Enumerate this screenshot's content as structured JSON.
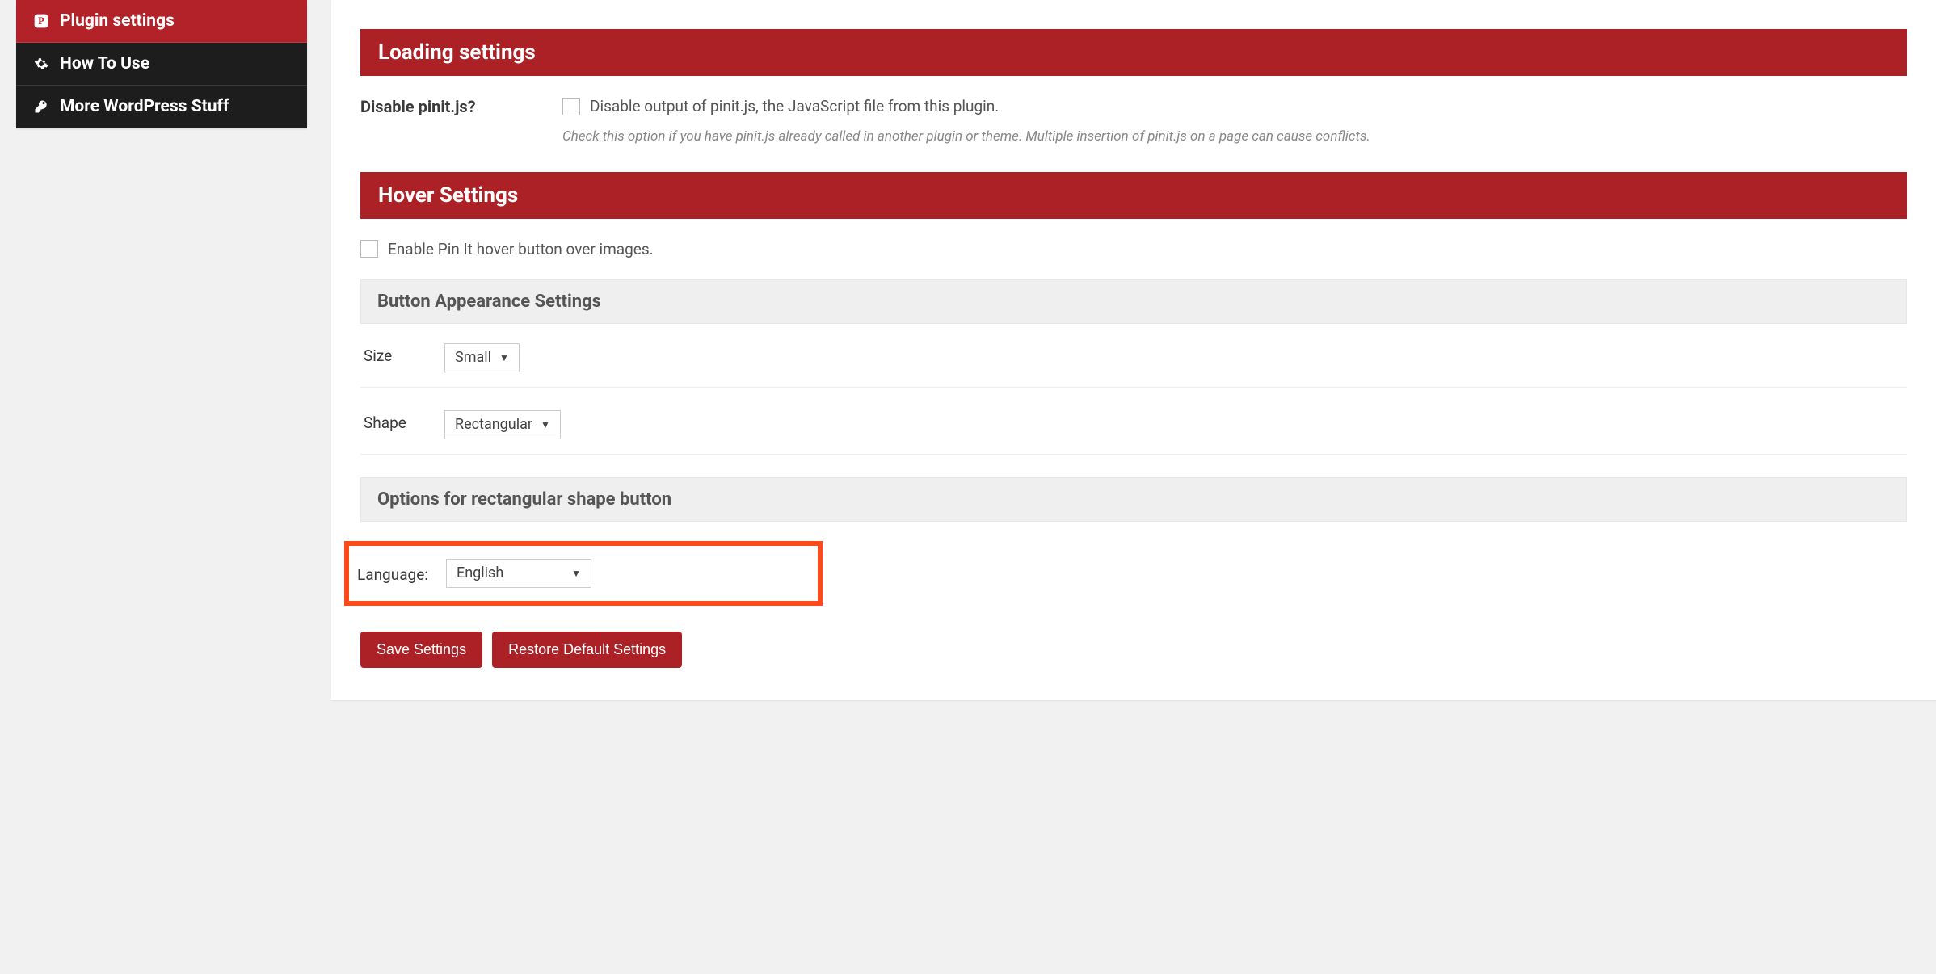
{
  "sidebar": {
    "items": [
      {
        "label": "Plugin settings"
      },
      {
        "label": "How To Use"
      },
      {
        "label": "More WordPress Stuff"
      }
    ]
  },
  "sections": {
    "loading": {
      "title": "Loading settings",
      "disable_label": "Disable pinit.js?",
      "disable_checkbox_label": "Disable output of pinit.js, the JavaScript file from this plugin.",
      "disable_help": "Check this option if you have pinit.js already called in another plugin or theme. Multiple insertion of pinit.js on a page can cause conflicts."
    },
    "hover": {
      "title": "Hover Settings",
      "enable_checkbox_label": "Enable Pin It hover button over images.",
      "appearance_title": "Button Appearance Settings",
      "size_label": "Size",
      "size_value": "Small",
      "shape_label": "Shape",
      "shape_value": "Rectangular",
      "rect_title": "Options for rectangular shape button",
      "language_label": "Language:",
      "language_value": "English"
    }
  },
  "buttons": {
    "save": "Save Settings",
    "restore": "Restore Default Settings"
  }
}
